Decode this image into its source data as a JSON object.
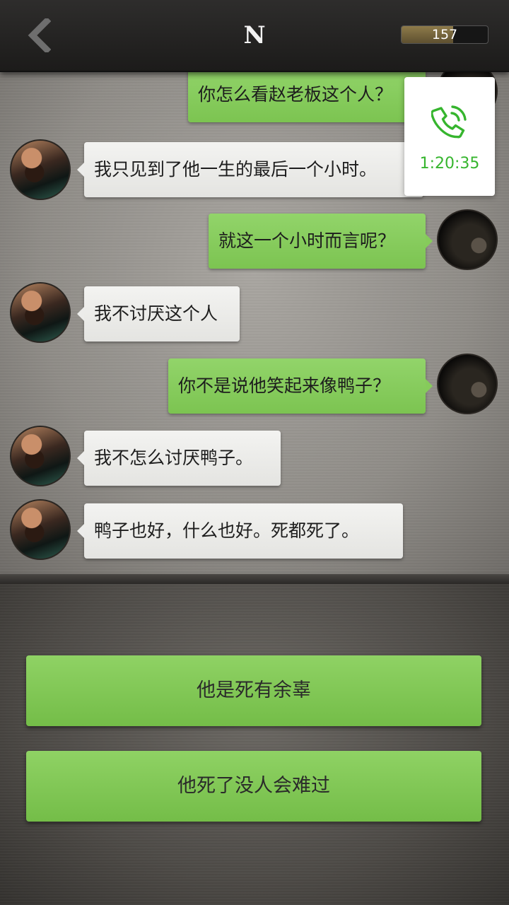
{
  "header": {
    "back_icon": "chevron-left-icon",
    "title": "N",
    "coins": "157",
    "coin_fill_fraction": 0.6
  },
  "messages": [
    {
      "side": "out",
      "text": "你怎么看赵老板这个人？"
    },
    {
      "side": "in",
      "text": "我只见到了他一生的最后一个小时。"
    },
    {
      "side": "out",
      "text": "就这一个小时而言呢？"
    },
    {
      "side": "in",
      "text": "我不讨厌这个人"
    },
    {
      "side": "out",
      "text": "你不是说他笑起来像鸭子？"
    },
    {
      "side": "in",
      "text": "我不怎么讨厌鸭子。"
    },
    {
      "side": "in",
      "text": "鸭子也好，什么也好。死都死了。"
    }
  ],
  "call": {
    "icon": "phone-icon",
    "timer": "1:20:35",
    "color": "#36b52e"
  },
  "choices": [
    {
      "label": "他是死有余辜"
    },
    {
      "label": "他死了没人会难过"
    }
  ],
  "colors": {
    "bubble_out": "#86cb5b",
    "bubble_in": "#ececea",
    "choice": "#82c856"
  }
}
